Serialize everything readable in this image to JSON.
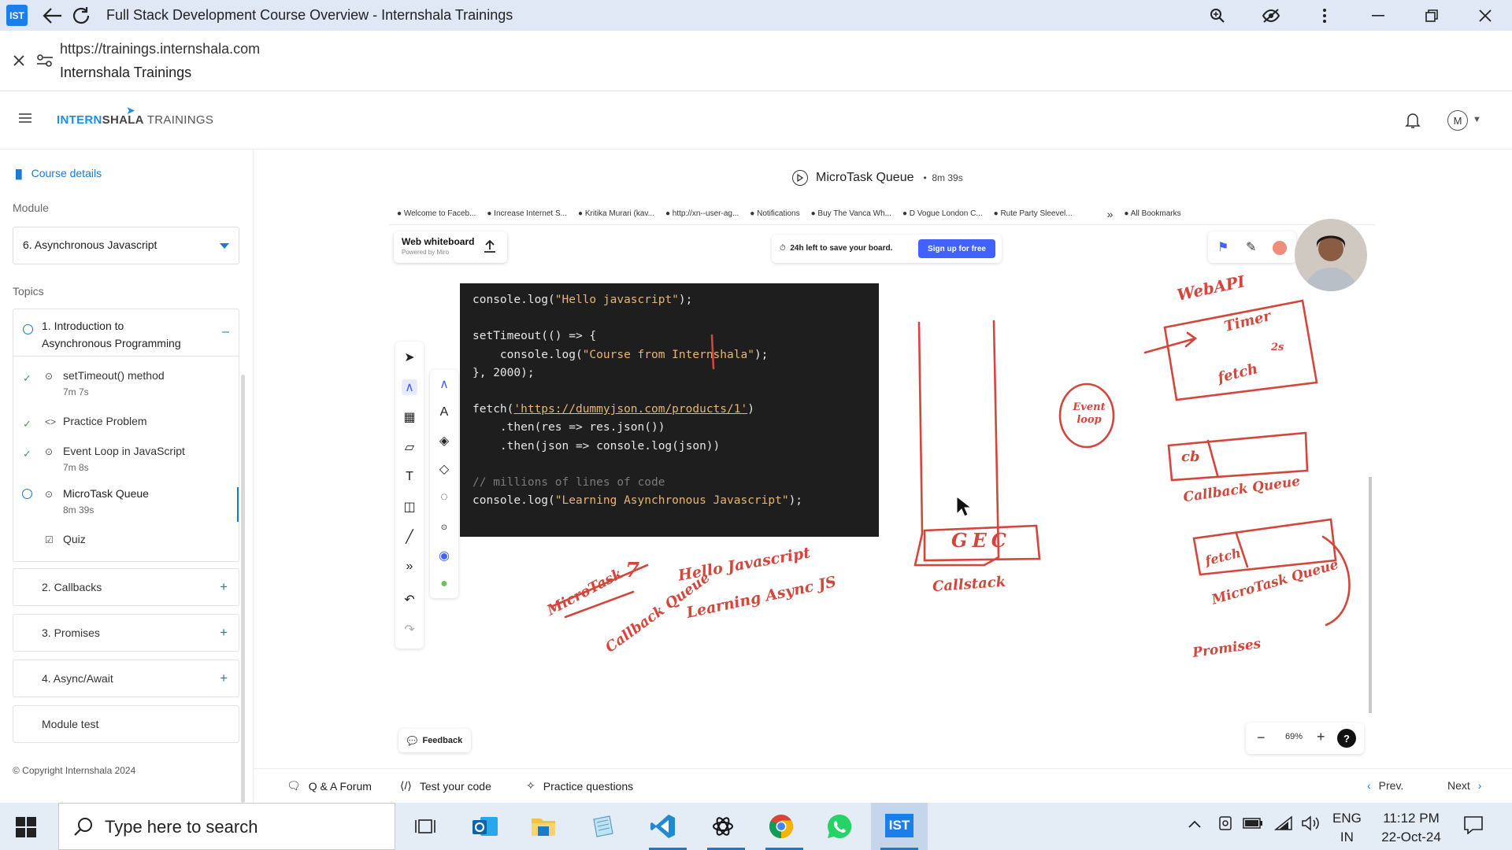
{
  "browser": {
    "app_badge": "IST",
    "title": "Full Stack Development Course Overview - Internshala Trainings",
    "url_host": "https://trainings.internshala.com",
    "site_name": "Internshala Trainings"
  },
  "header": {
    "logo_a": "INTERN",
    "logo_b": "SHALA",
    "logo_c": "TRAININGS",
    "avatar_initial": "M"
  },
  "sidebar": {
    "course_details": "Course details",
    "module_label": "Module",
    "module_selected": "6. Asynchronous Javascript",
    "topics_label": "Topics",
    "topic1_title_line1": "1. Introduction to",
    "topic1_title_line2": "Asynchronous Programming",
    "items": [
      {
        "name": "setTimeout() method",
        "duration": "7m 7s"
      },
      {
        "name": "Practice Problem",
        "duration": ""
      },
      {
        "name": "Event Loop in JavaScript",
        "duration": "7m 8s"
      },
      {
        "name": "MicroTask Queue",
        "duration": "8m 39s"
      },
      {
        "name": "Quiz",
        "duration": ""
      }
    ],
    "modules": [
      {
        "name": "2. Callbacks"
      },
      {
        "name": "3. Promises"
      },
      {
        "name": "4. Async/Await"
      },
      {
        "name": "Module test"
      }
    ],
    "copyright": "© Copyright Internshala 2024"
  },
  "video": {
    "title": "MicroTask Queue",
    "duration": "8m 39s",
    "bookmarks": [
      "Welcome to Faceb...",
      "Increase Internet S...",
      "Kritika Murari (kav...",
      "http://xn--user-ag...",
      "Notifications",
      "Buy The Vanca Wh...",
      "D Vogue London C...",
      "Rute Party Sleevel...",
      "»",
      "All Bookmarks"
    ],
    "whiteboard_title": "Web whiteboard",
    "whiteboard_sub": "Powered by Miro",
    "save_text": "24h left to save your board.",
    "signup": "Sign up for free",
    "code_lines": [
      "console.log(\"Hello javascript\");",
      "",
      "setTimeout(() => {",
      "    console.log(\"Course from Internshala\");",
      "}, 2000);",
      "",
      "fetch('https://dummyjson.com/products/1')",
      "    .then(res => res.json())",
      "    .then(json => console.log(json))",
      "",
      "// millions of lines of code",
      "console.log(\"Learning Asynchronous Javascript\");"
    ],
    "feedback": "Feedback",
    "zoom_level": "69%",
    "ink_color": "#d2463c",
    "handwriting": {
      "web_api": "WebAPI",
      "timer": "Timer",
      "two_s": "2s",
      "fetch": "fetch",
      "event_loop": "Event loop",
      "cb": "cb",
      "callback_queue": "Callback Queue",
      "fetch2": "fetch",
      "microtask_queue": "MicroTask Queue",
      "promises": "Promises",
      "gec": "GEC",
      "callstack": "Callstack",
      "hello_js": "Hello Javascript",
      "learning": "Learning Async JS",
      "microtask_left": "MicroTask",
      "seven": "7",
      "callback_queue_left": "Callback Queue"
    }
  },
  "bottom": {
    "qa": "Q & A Forum",
    "test": "Test your code",
    "practice": "Practice questions",
    "prev": "Prev.",
    "next": "Next"
  },
  "taskbar": {
    "search_placeholder": "Type here to search",
    "ist": "IST",
    "lang1": "ENG",
    "lang2": "IN",
    "time": "11:12 PM",
    "date": "22-Oct-24"
  }
}
